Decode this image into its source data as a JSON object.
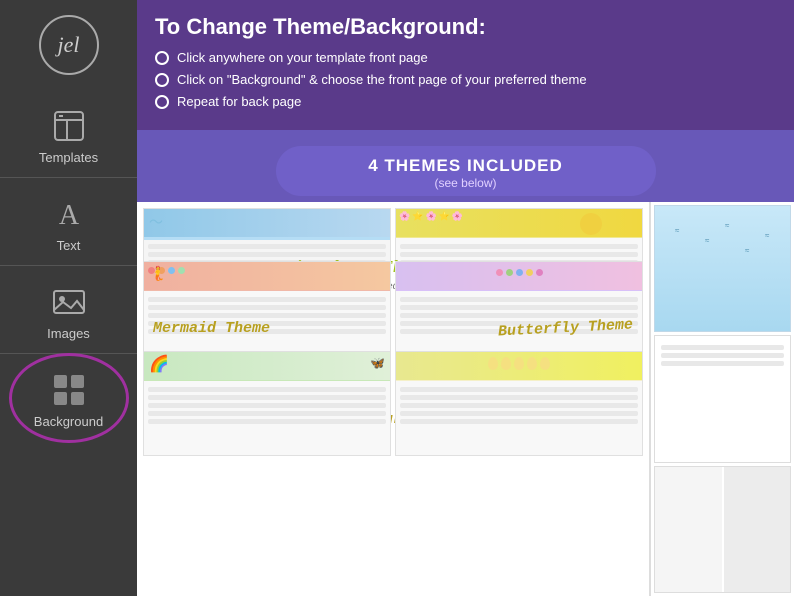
{
  "sidebar": {
    "logo_text": "jel",
    "items": [
      {
        "id": "templates",
        "label": "Templates",
        "icon": "template-icon"
      },
      {
        "id": "text",
        "label": "Text",
        "icon": "text-icon"
      },
      {
        "id": "images",
        "label": "Images",
        "icon": "images-icon"
      },
      {
        "id": "background",
        "label": "Background",
        "icon": "background-icon",
        "active": true
      }
    ]
  },
  "instruction_panel": {
    "title": "To Change Theme/Background:",
    "steps": [
      "Click anywhere on your template front page",
      "Click on \"Background\" & choose the front page of your preferred theme",
      "Repeat for back page"
    ]
  },
  "themes_header": {
    "title": "4 THEMES INCLUDED",
    "subtitle": "(see below)"
  },
  "themes": [
    {
      "id": "morning",
      "label": "Morning Theme: Flowers/ Star Leaves",
      "sublabel": "(or Night Theme in Bedtime Chart Template)"
    },
    {
      "id": "mermaid",
      "label": "Mermaid  Theme"
    },
    {
      "id": "butterfly",
      "label": "Butterfly Theme"
    },
    {
      "id": "dinosaur",
      "label": "Dinosaur Theme"
    }
  ]
}
